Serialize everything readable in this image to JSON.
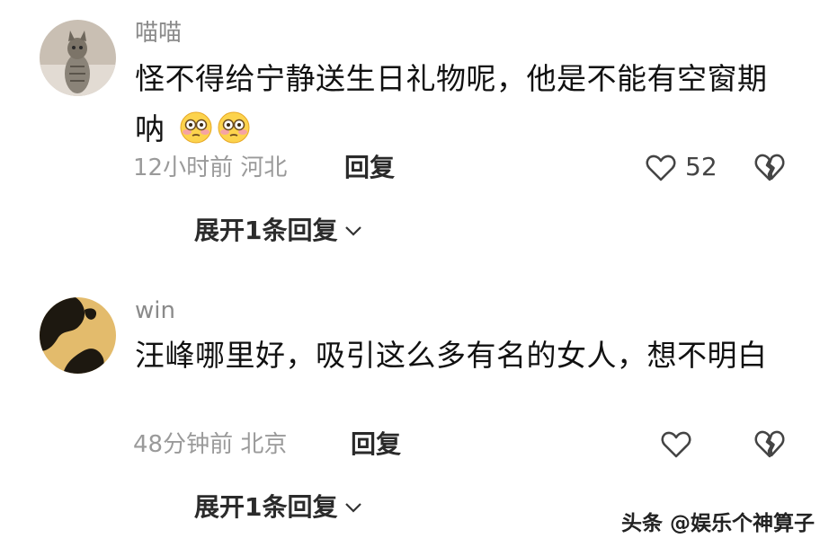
{
  "comments": [
    {
      "username": "喵喵",
      "text": "怪不得给宁静送生日礼物呢，他是不能有空窗期呐",
      "emojis": [
        "flushed-face",
        "flushed-face"
      ],
      "time": "12小时前",
      "location": "河北",
      "reply_label": "回复",
      "like_count": "52",
      "expand_label": "展开1条回复",
      "avatar": "cat-photo"
    },
    {
      "username": "win",
      "text": "汪峰哪里好，吸引这么多有名的女人，想不明白",
      "time": "48分钟前",
      "location": "北京",
      "reply_label": "回复",
      "like_count": "",
      "expand_label": "展开1条回复",
      "avatar": "hands-silhouette"
    }
  ],
  "watermark": "头条 @娱乐个神算子",
  "colors": {
    "username": "#8a8a8a",
    "text": "#111111",
    "meta": "#9a9a9a",
    "background": "#ffffff"
  }
}
